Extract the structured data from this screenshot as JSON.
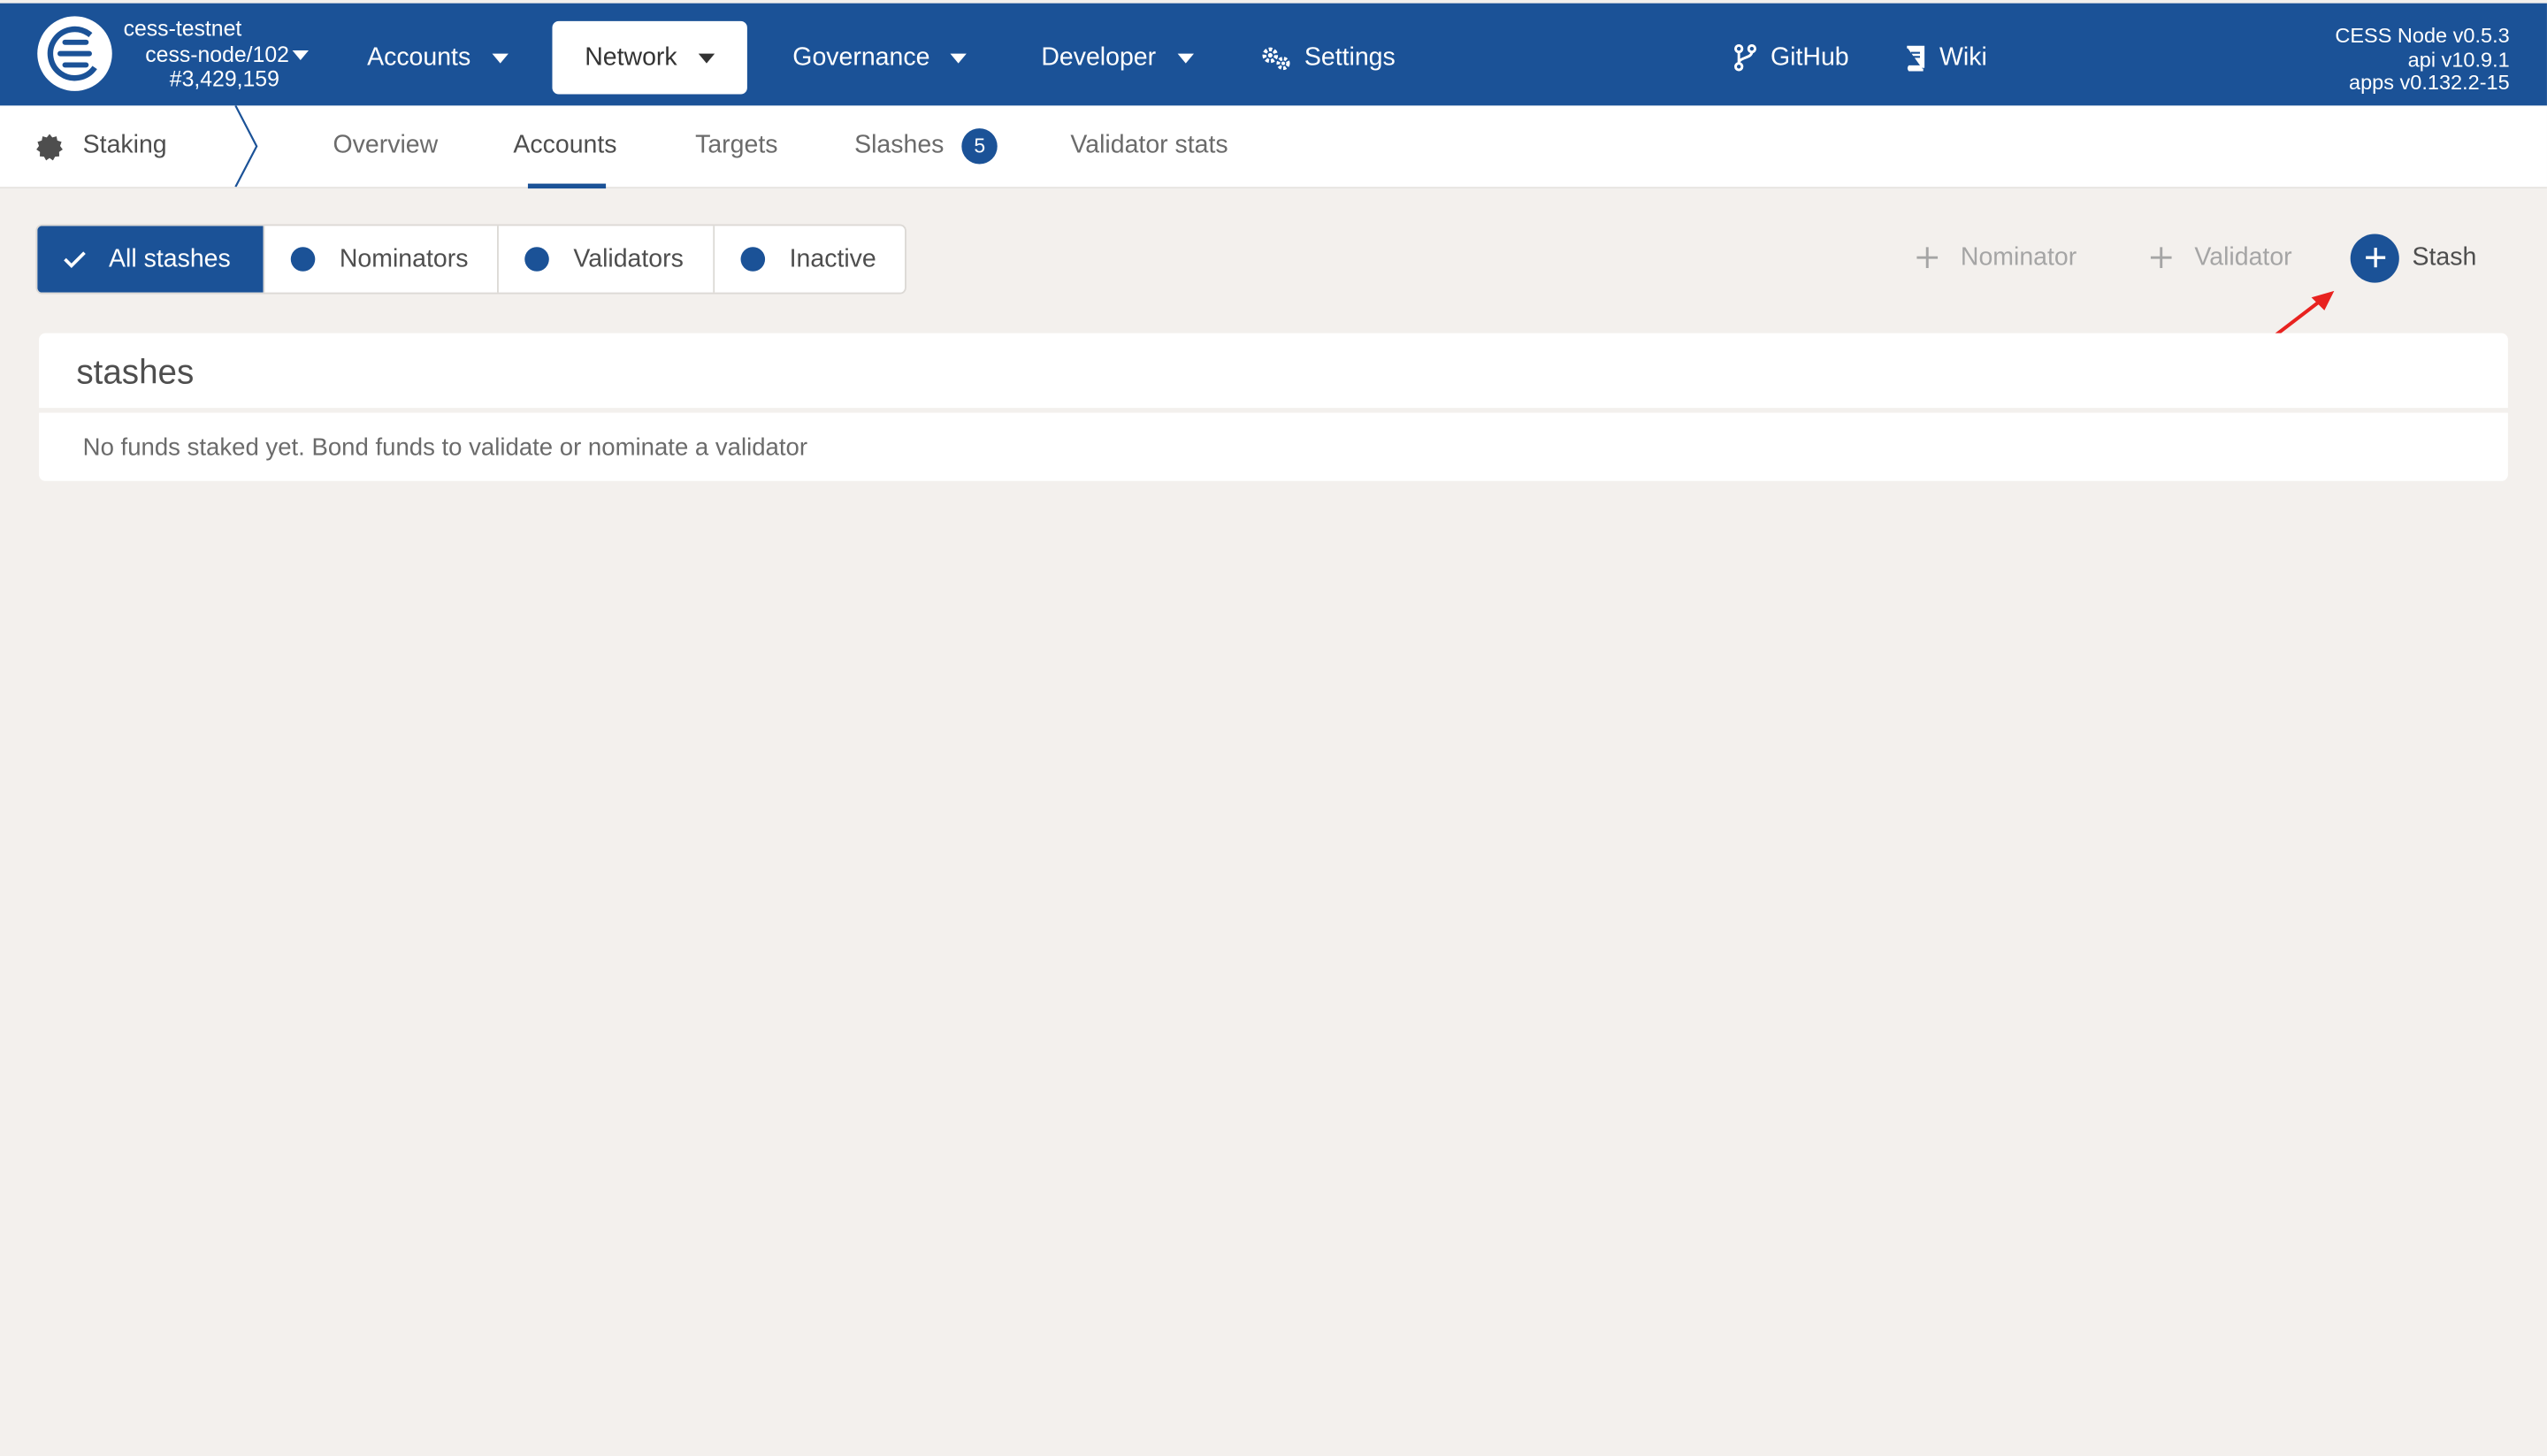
{
  "header": {
    "chain_name": "cess-testnet",
    "node_name": "cess-node/102",
    "block_number": "#3,429,159",
    "menu": {
      "accounts": "Accounts",
      "network": "Network",
      "governance": "Governance",
      "developer": "Developer",
      "settings": "Settings",
      "github": "GitHub",
      "wiki": "Wiki"
    },
    "versions": {
      "node": "CESS Node v0.5.3",
      "api": "api v10.9.1",
      "apps": "apps v0.132.2-15"
    }
  },
  "subnav": {
    "section": "Staking",
    "tabs": {
      "overview": "Overview",
      "accounts": "Accounts",
      "targets": "Targets",
      "slashes": "Slashes",
      "validator_stats": "Validator stats"
    },
    "slashes_count": "5"
  },
  "filters": {
    "all": "All stashes",
    "nominators": "Nominators",
    "validators": "Validators",
    "inactive": "Inactive"
  },
  "actions": {
    "nominator": "Nominator",
    "validator": "Validator",
    "stash": "Stash"
  },
  "stashes": {
    "title": "stashes",
    "empty_message": "No funds staked yet. Bond funds to validate or nominate a validator"
  },
  "colors": {
    "brand": "#1b5297",
    "background": "#f3f0ed",
    "annotation_arrow": "#e8221f"
  }
}
